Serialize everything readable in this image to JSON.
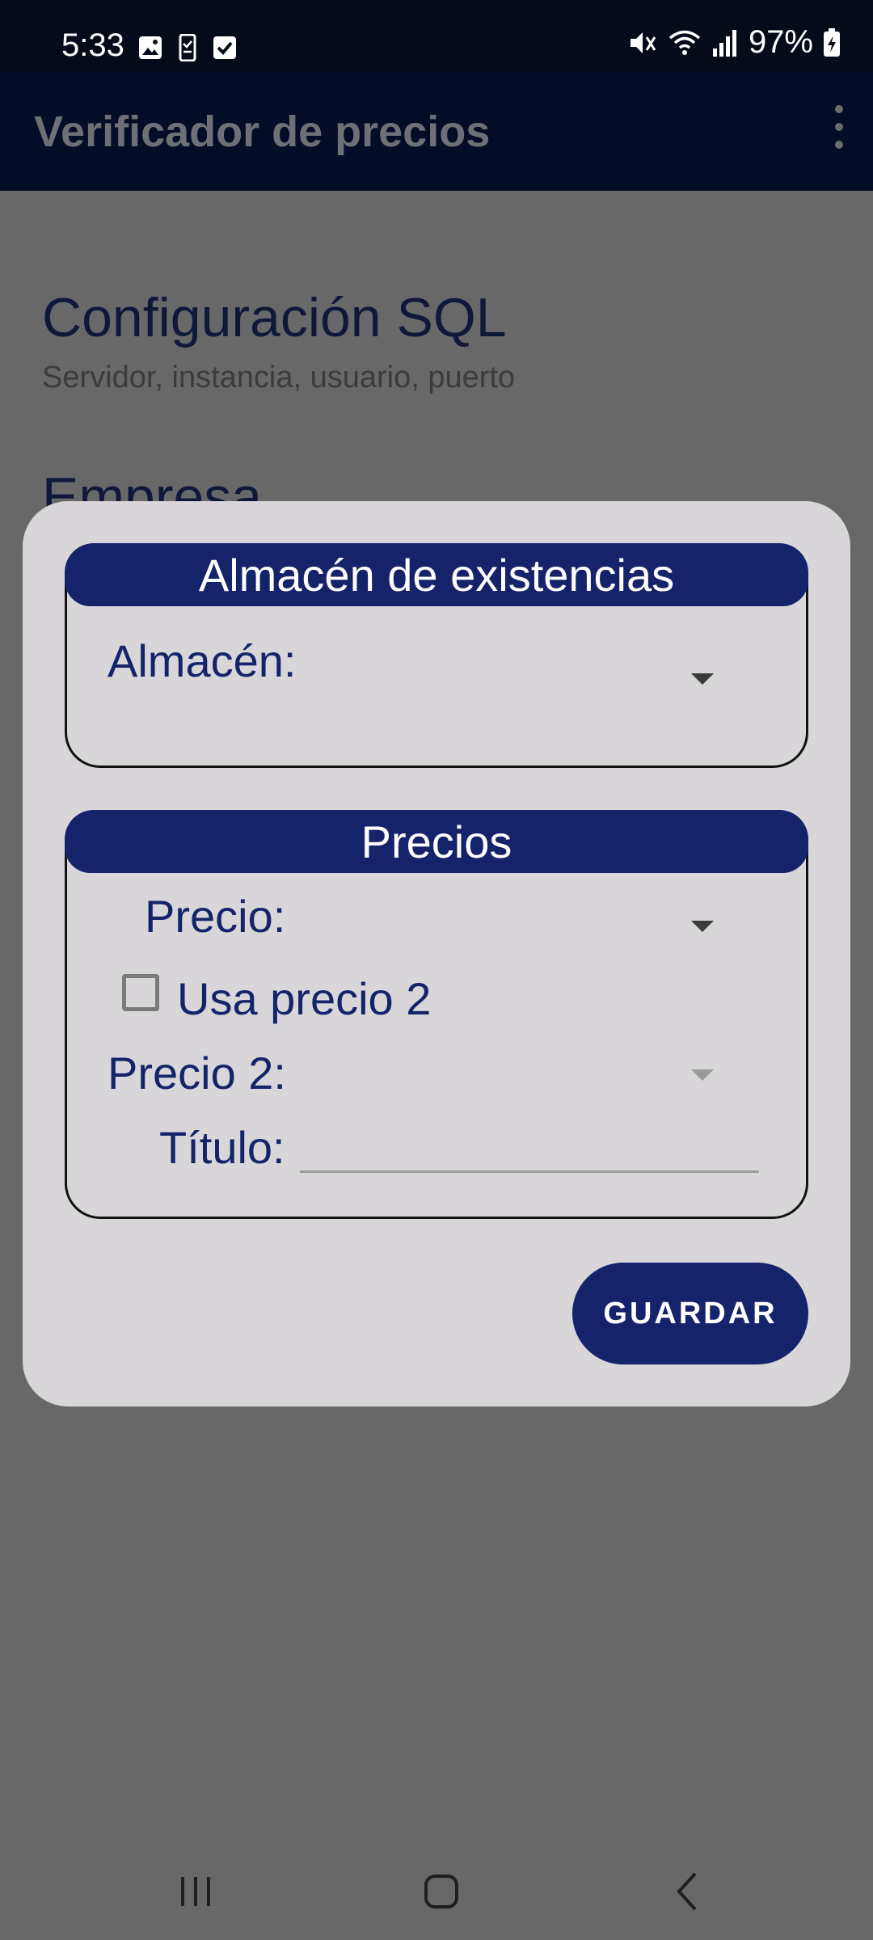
{
  "status_bar": {
    "time": "5:33",
    "battery": "97%",
    "left_icons": [
      "image-icon",
      "phone-icon",
      "check-box-icon"
    ],
    "right_icons": [
      "mute-icon",
      "wifi-icon",
      "signal-icon",
      "battery-charging-icon"
    ]
  },
  "app_bar": {
    "title": "Verificador de precios",
    "menu_icon": "more-vert-icon"
  },
  "settings": {
    "items": [
      {
        "title": "Configuración SQL",
        "summary": "Servidor, instancia, usuario, puerto"
      },
      {
        "title": "Empresa",
        "summary": ""
      }
    ]
  },
  "dialog": {
    "stock_group": {
      "header": "Almacén de existencias",
      "warehouse_label": "Almacén:",
      "warehouse_value": ""
    },
    "price_group": {
      "header": "Precios",
      "price_label": "Precio:",
      "price_value": "",
      "use_price2_label": "Usa precio 2",
      "use_price2_checked": false,
      "price2_label": "Precio 2:",
      "price2_value": "",
      "title_label": "Título:",
      "title_value": ""
    },
    "save_label": "GUARDAR"
  },
  "colors": {
    "primary": "#15236a",
    "app_bar": "#050c27",
    "dialog_bg": "#d8d6d8",
    "scrim": "#686868"
  },
  "nav_bar": {
    "icons": [
      "recent-apps-icon",
      "home-icon",
      "back-icon"
    ]
  }
}
